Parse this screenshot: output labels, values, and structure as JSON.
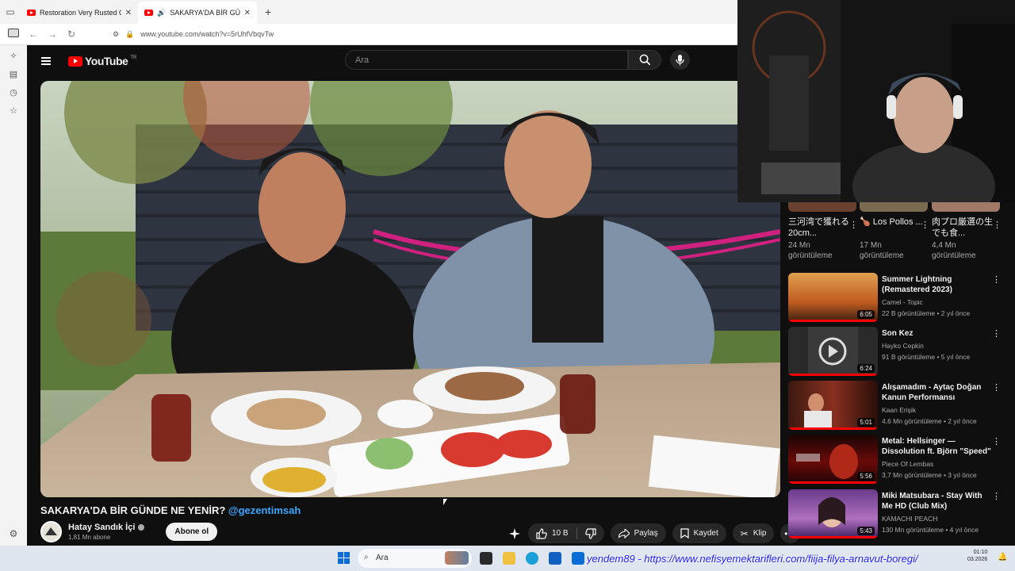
{
  "browser": {
    "tabs": [
      {
        "label": "Restoration Very Rusted Old Su",
        "active": false
      },
      {
        "label": "SAKARYA'DA BİR GÜNDE N",
        "active": true
      }
    ],
    "url": "www.youtube.com/watch?v=5rUhfVbqvTw"
  },
  "youtube": {
    "logo": "YouTube",
    "logo_region": "TR",
    "search_placeholder": "Ara",
    "video": {
      "title": "SAKARYA'DA BİR GÜNDE NE YENİR?",
      "mention": "@gezentimsah",
      "channel": "Hatay Sandık İçi",
      "subscribers": "1,81 Mn abone",
      "subscribe_label": "Abone ol",
      "likes": "10 B",
      "share_label": "Paylaş",
      "save_label": "Kaydet",
      "clip_label": "Klip"
    },
    "shorts": [
      {
        "title": "三河湾で獲れる20cm...",
        "views": "24 Mn görüntüleme"
      },
      {
        "title": "🍗 Los Pollos ...",
        "views": "17 Mn görüntüleme"
      },
      {
        "title": "肉プロ厳選の生でも食...",
        "views": "4,4 Mn görüntüleme"
      }
    ],
    "recommendations": [
      {
        "title": "Summer Lightning (Remastered 2023)",
        "channel": "Camel - Topic",
        "meta": "22 B görüntüleme • 2 yıl önce",
        "duration": "6:05",
        "progress": 1.0
      },
      {
        "title": "Son Kez",
        "channel": "Hayko Cepkin",
        "meta": "91 B görüntüleme • 5 yıl önce",
        "duration": "6:24",
        "progress": 1.0
      },
      {
        "title": "Alışamadım - Aytaç Doğan Kanun Performansı",
        "channel": "Kaan Erişik",
        "meta": "4,6 Mn görüntüleme • 2 yıl önce",
        "duration": "5:01",
        "progress": 1.0
      },
      {
        "title": "Metal: Hellsinger — Dissolution ft. Björn \"Speed\" Strid from ...",
        "channel": "Piece Of Lembas",
        "meta": "3,7 Mn görüntüleme • 3 yıl önce",
        "duration": "5:56",
        "progress": 1.0
      },
      {
        "title": "Miki Matsubara - Stay With Me HD (Club Mix)",
        "channel": "KAMACHI PEACH",
        "meta": "130 Mn görüntüleme • 4 yıl önce",
        "duration": "5:43",
        "progress": 1.0
      }
    ]
  },
  "taskbar": {
    "search_label": "Ara",
    "ticker": "yendem89 - https://www.nefisyemektarifleri.com/fiija-filya-arnavut-boregi/",
    "time": "01:10",
    "date": "03.2026"
  }
}
